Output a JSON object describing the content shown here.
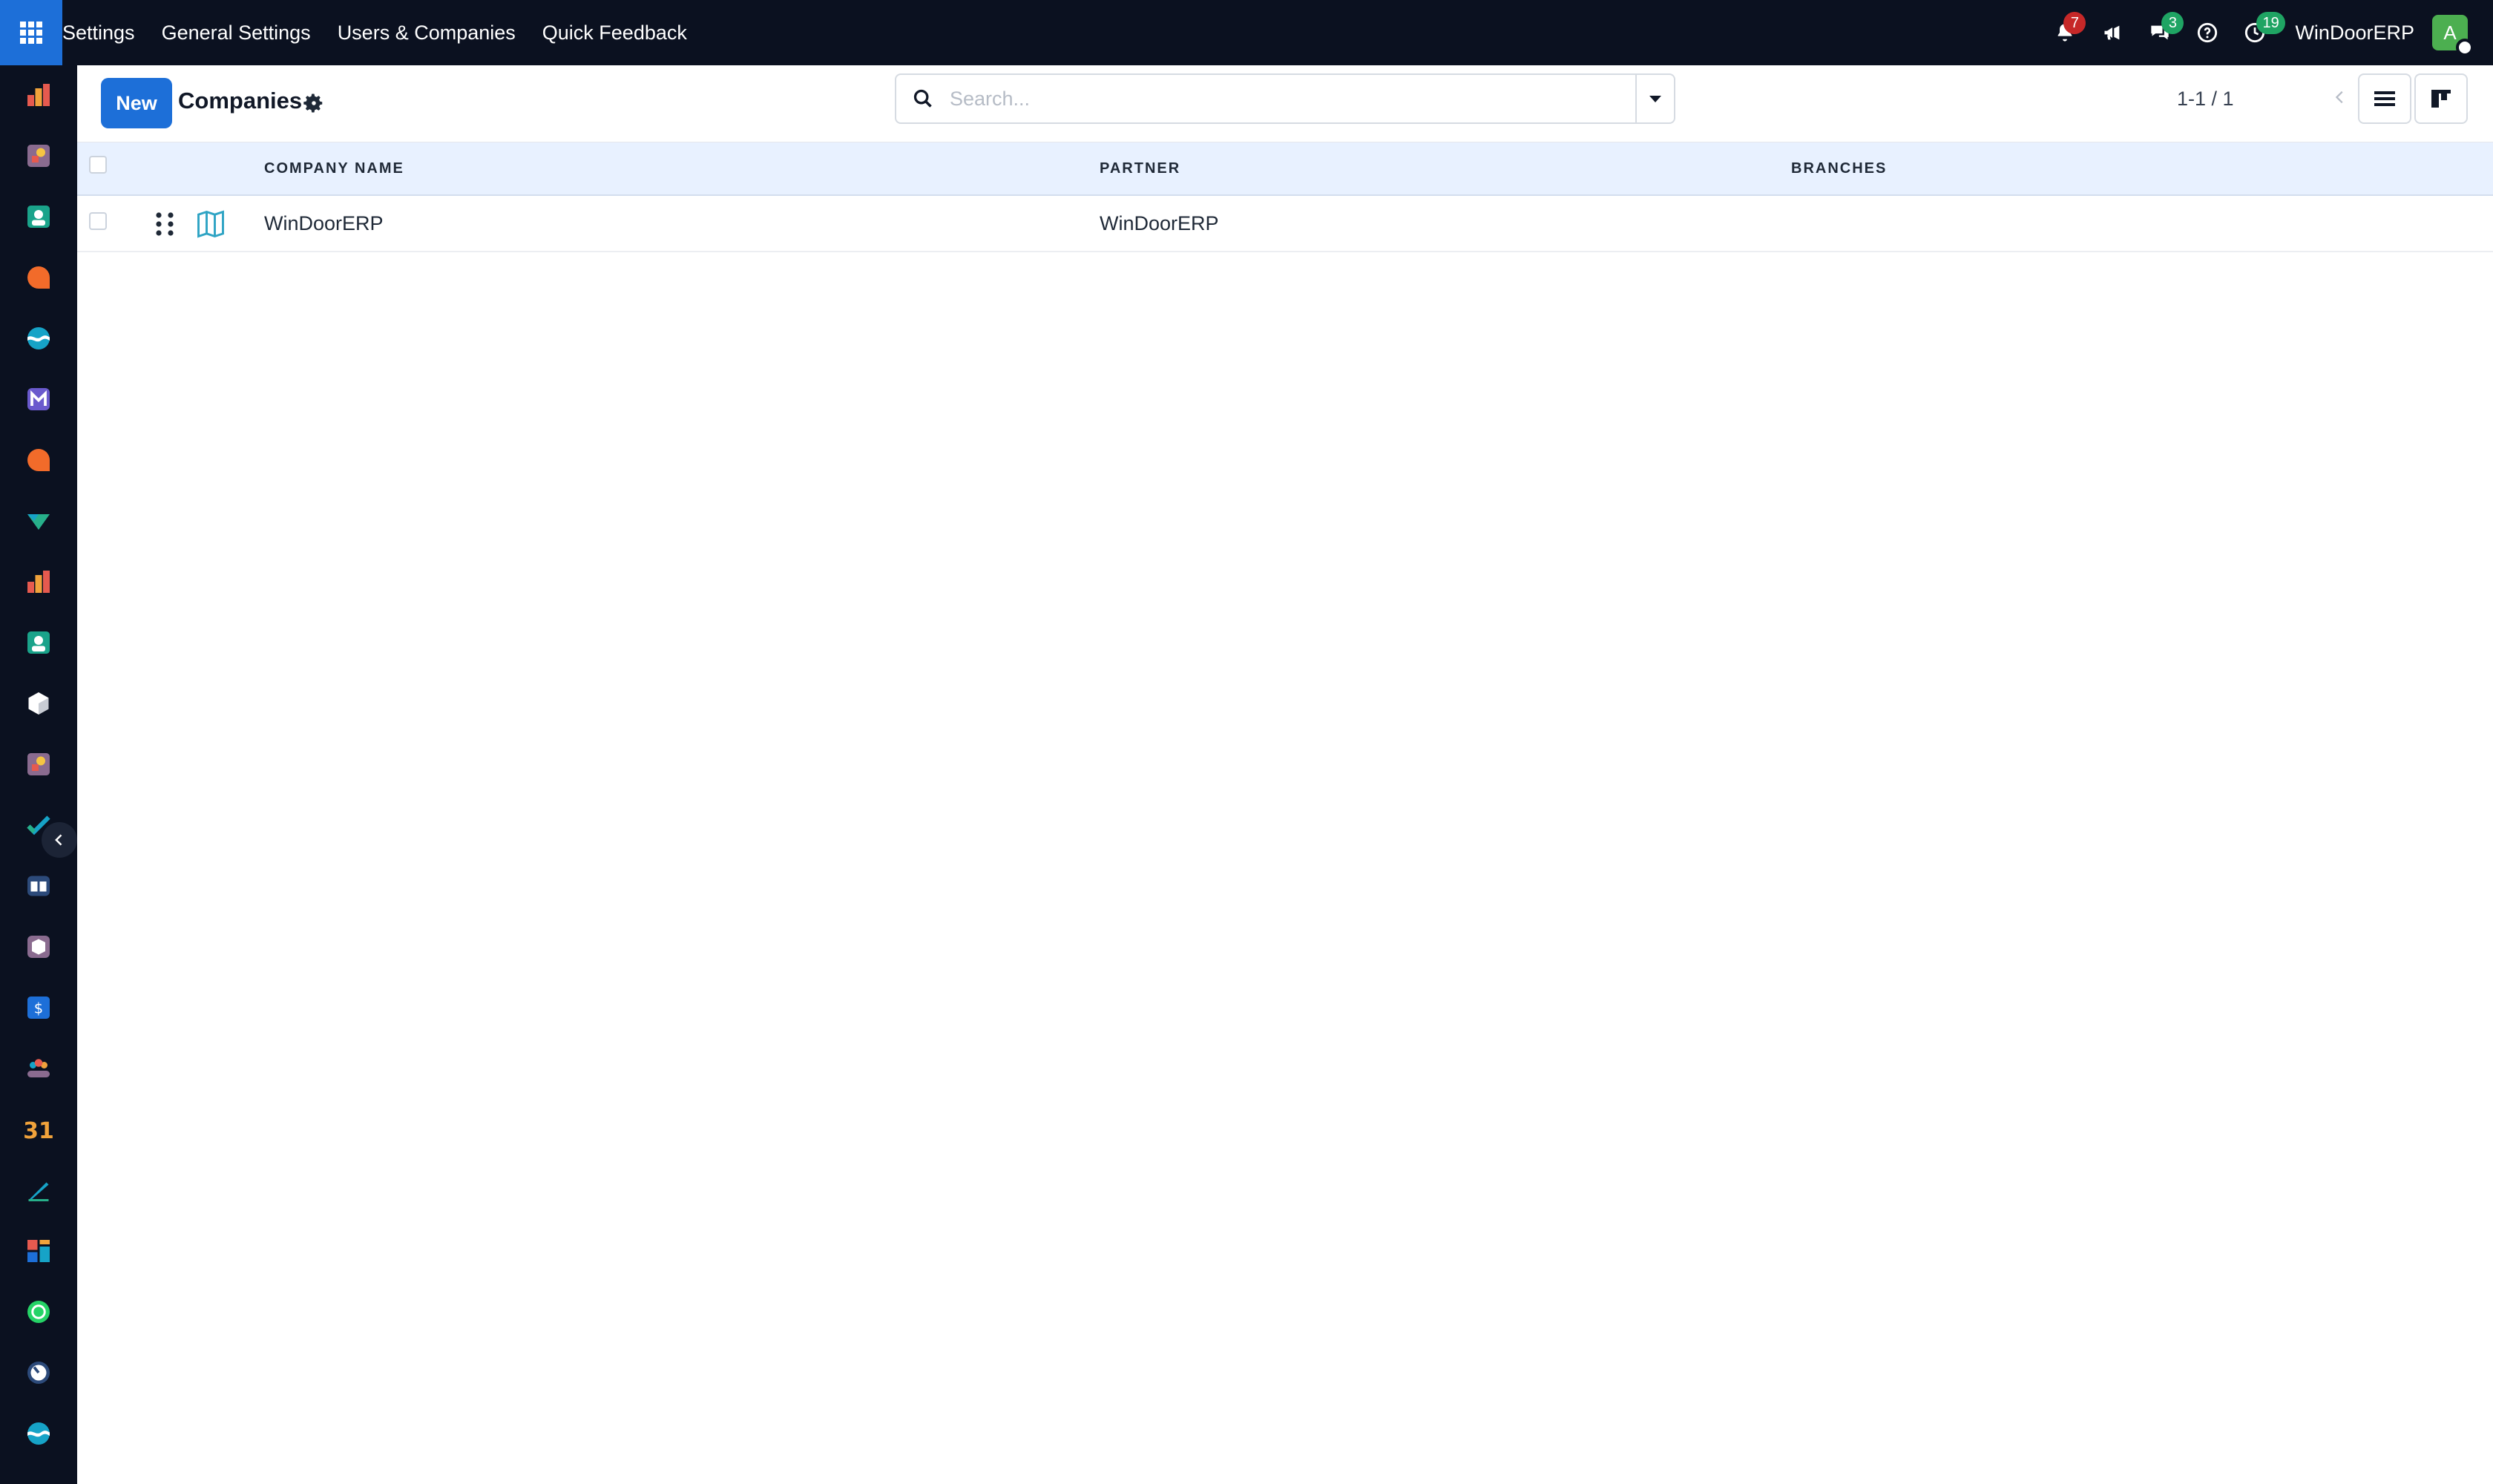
{
  "topbar": {
    "menu": [
      "Settings",
      "General Settings",
      "Users & Companies",
      "Quick Feedback"
    ],
    "notifications_count": "7",
    "messages_count": "3",
    "activities_count": "19",
    "company_name": "WinDoorERP",
    "avatar_initial": "A"
  },
  "rail": {
    "apps": [
      "dashboard-icon",
      "puzzle-icon",
      "contacts-icon",
      "chat-icon",
      "discuss-wave-icon",
      "email-marketing-icon",
      "livechat-icon",
      "planning-icon",
      "dashboard-icon",
      "contacts-icon",
      "inventory-icon",
      "puzzle-icon",
      "project-icon",
      "knowledge-icon",
      "box-icon",
      "invoicing-icon",
      "employees-icon",
      "calendar-icon",
      "sign-icon",
      "dashboards-icon",
      "whatsapp-icon",
      "timer-icon",
      "discuss-wave-icon"
    ]
  },
  "control": {
    "new_label": "New",
    "breadcrumb": "Companies",
    "search_placeholder": "Search...",
    "pager": "1-1 / 1"
  },
  "table": {
    "columns": [
      "COMPANY NAME",
      "PARTNER",
      "BRANCHES"
    ],
    "rows": [
      {
        "company_name": "WinDoorERP",
        "partner": "WinDoorERP",
        "branches": ""
      }
    ]
  },
  "colors": {
    "navbar": "#0b1120",
    "primary": "#1d6fd8",
    "header_bg": "#e8f1ff"
  }
}
